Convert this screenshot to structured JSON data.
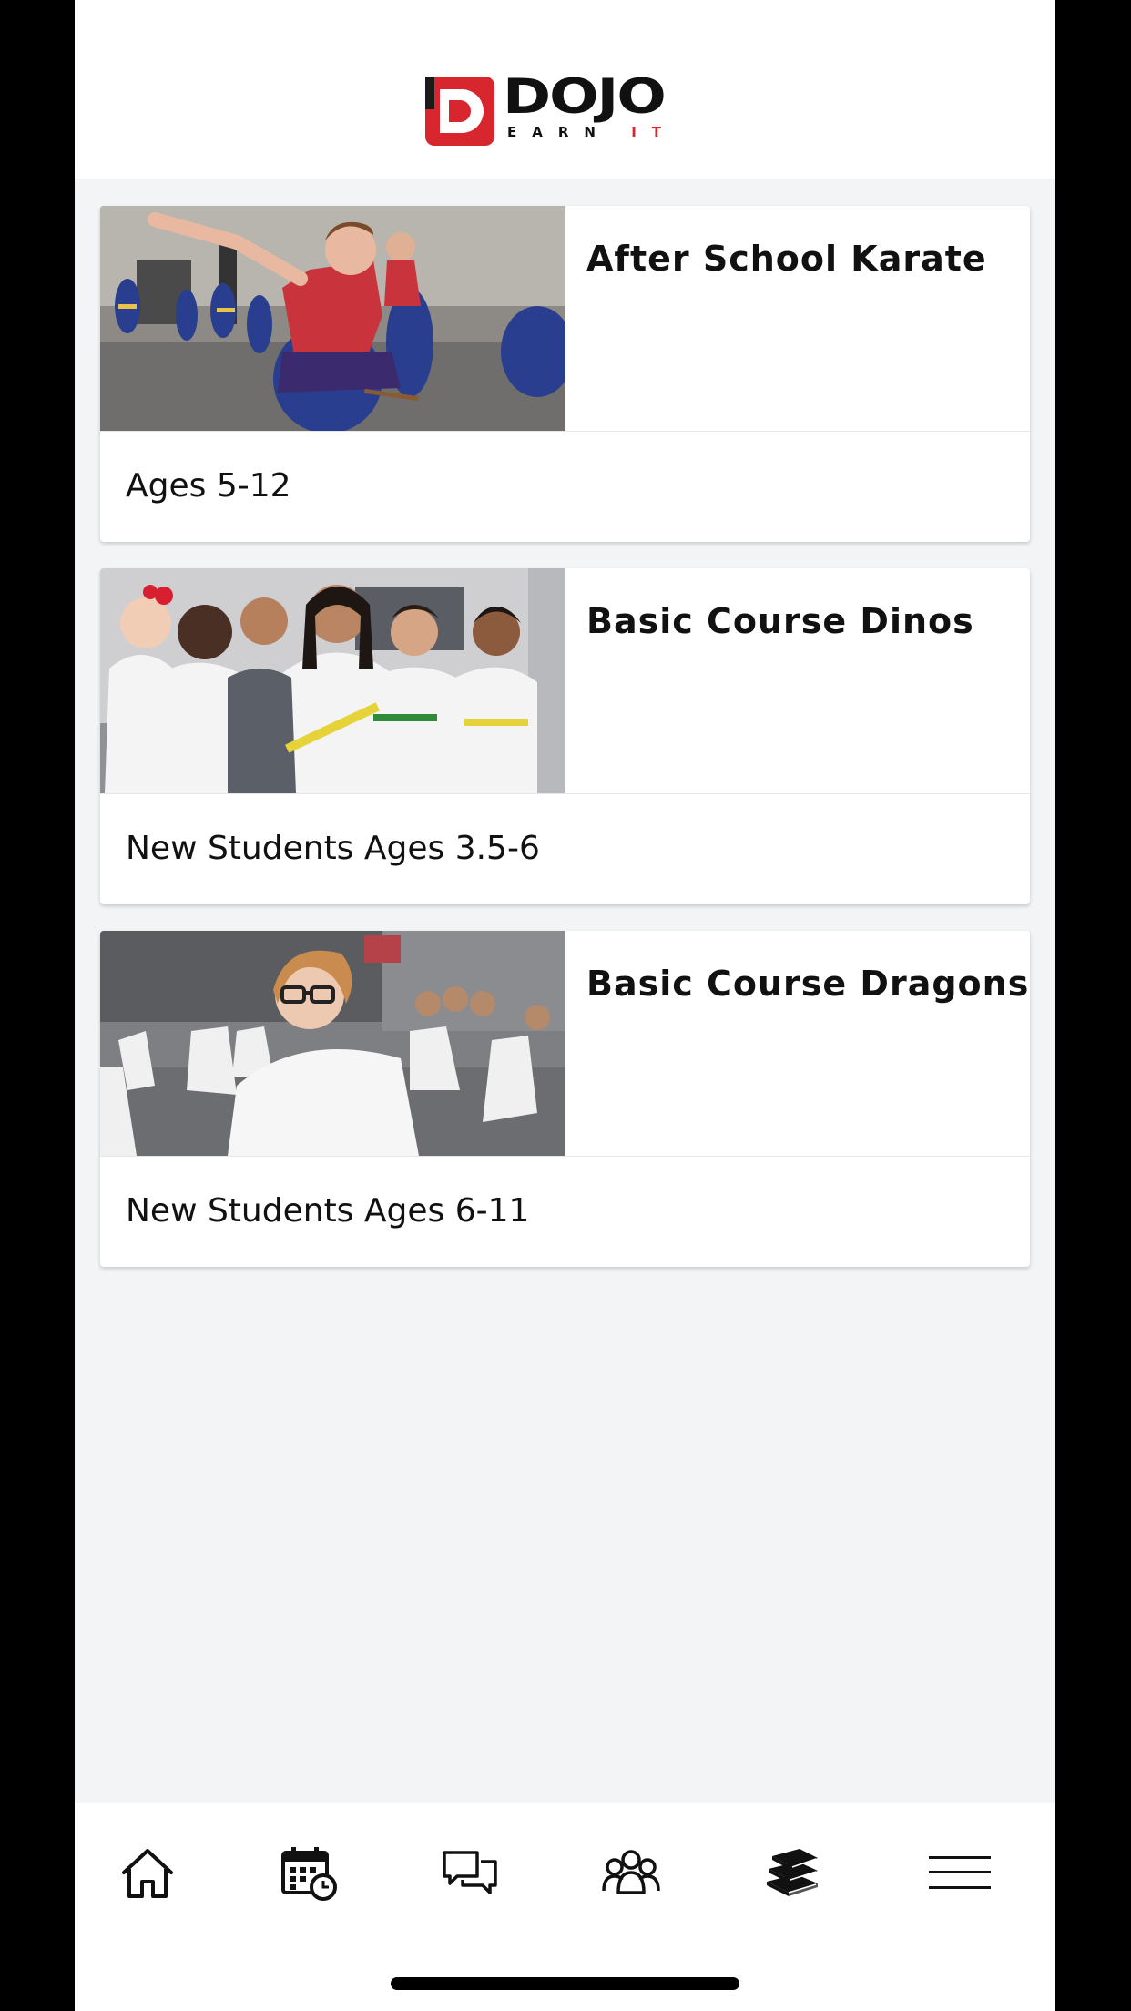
{
  "brand": {
    "name": "DOJO",
    "tagline_main": "EARN",
    "tagline_accent": "IT",
    "accent_color": "#d7262e"
  },
  "programs": [
    {
      "title": "After School Karate",
      "subtitle": "Ages 5-12",
      "photo": "karate-kids-blue-gi-photo"
    },
    {
      "title": "Basic Course Dinos",
      "subtitle": "New Students Ages 3.5-6",
      "photo": "young-kids-white-gi-photo"
    },
    {
      "title": "Basic Course Dragons",
      "subtitle": "New Students Ages 6-11",
      "photo": "girl-glasses-white-gi-photo"
    }
  ],
  "tabbar": {
    "items": [
      {
        "icon": "home-icon"
      },
      {
        "icon": "calendar-clock-icon"
      },
      {
        "icon": "chat-bubbles-icon"
      },
      {
        "icon": "people-group-icon"
      },
      {
        "icon": "books-icon"
      },
      {
        "icon": "menu-icon"
      }
    ]
  }
}
